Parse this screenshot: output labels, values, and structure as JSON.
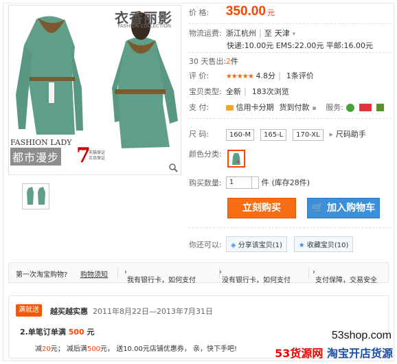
{
  "brand": {
    "name": "衣香丽影",
    "sub": "FASHION COLLECTION"
  },
  "watermark": {
    "line1": "FASHION LADY",
    "line2": "都市漫步",
    "num": "7",
    "small": "天猫保证 正品保证"
  },
  "price": {
    "label": "价      格:",
    "value": "350.00",
    "unit": "元"
  },
  "shipping": {
    "label": "物流运费:",
    "from": "浙江杭州",
    "to_sep": "至",
    "to": "天津",
    "fees": "快递:10.00元   EMS:22.00元   平邮:16.00元"
  },
  "sales": {
    "label": "30 天售出:",
    "value": "2",
    "unit": "件"
  },
  "rating": {
    "label": "评      价:",
    "stars": "★★★★★",
    "score": "4.8分",
    "reviews": "1条评价"
  },
  "item_type": {
    "label": "宝贝类型:",
    "value": "全新",
    "views": "183次浏览"
  },
  "payment": {
    "label": "支      付:",
    "method1": "信用卡分期",
    "method2": "货到付款",
    "service_label": "服务:"
  },
  "size": {
    "label": "尺      码:",
    "options": [
      "160-M",
      "165-L",
      "170-XL"
    ],
    "helper": "尺码助手"
  },
  "color": {
    "label": "颜色分类:"
  },
  "quantity": {
    "label": "购买数量:",
    "value": "1",
    "unit": "件",
    "stock": "(库存28件)"
  },
  "buttons": {
    "buy": "立刻购买",
    "cart": "加入购物车"
  },
  "share": {
    "label": "你还可以:",
    "share": "分享该宝贝(1)",
    "fav": "收藏宝贝(10)"
  },
  "tips": {
    "first": "第一次淘宝购物?",
    "guide": "购物须知",
    "t1": "我有银行卡，如何支付",
    "t2": "没有银行卡，如何支付",
    "t3": "支付保障，交易安全"
  },
  "promo": {
    "tag": "满就送",
    "title": "越买越实惠",
    "date": "2011年8月22日—2013年7月31日",
    "line1_a": "2.单笔订单满",
    "line1_b": "500",
    "line1_c": "元",
    "line2_a": "减",
    "line2_b": "20",
    "line2_c": "元；  减后满",
    "line2_d": "500",
    "line2_e": "元，  送10.00元店铺优惠券，  亲，快下手吧!"
  },
  "site_watermark": {
    "url": "53shop.com",
    "a": "53货源网",
    "b": "淘宝开店货源"
  },
  "colors": {
    "accent": "#ff4400",
    "buy": "#f66d13",
    "cart": "#3d8fd9"
  }
}
